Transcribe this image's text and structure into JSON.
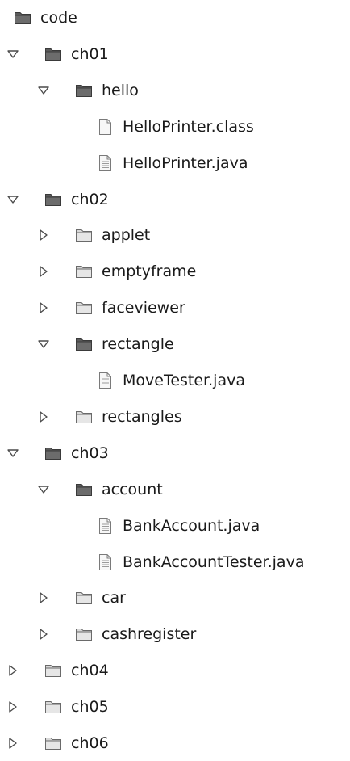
{
  "tree": {
    "nodes": [
      {
        "label": "code",
        "type": "folder",
        "level": 0,
        "toggle": "none",
        "icon": "folder-dark-icon"
      },
      {
        "label": "ch01",
        "type": "folder",
        "level": 0,
        "toggle": "expanded",
        "icon": "folder-dark-icon"
      },
      {
        "label": "hello",
        "type": "folder",
        "level": 1,
        "toggle": "expanded",
        "icon": "folder-dark-icon"
      },
      {
        "label": "HelloPrinter.class",
        "type": "file",
        "level": 2,
        "toggle": "none",
        "icon": "file-icon"
      },
      {
        "label": "HelloPrinter.java",
        "type": "file",
        "level": 2,
        "toggle": "none",
        "icon": "java-file-icon"
      },
      {
        "label": "ch02",
        "type": "folder",
        "level": 0,
        "toggle": "expanded",
        "icon": "folder-dark-icon"
      },
      {
        "label": "applet",
        "type": "folder",
        "level": 1,
        "toggle": "collapsed",
        "icon": "folder-light-icon"
      },
      {
        "label": "emptyframe",
        "type": "folder",
        "level": 1,
        "toggle": "collapsed",
        "icon": "folder-light-icon"
      },
      {
        "label": "faceviewer",
        "type": "folder",
        "level": 1,
        "toggle": "collapsed",
        "icon": "folder-light-icon"
      },
      {
        "label": "rectangle",
        "type": "folder",
        "level": 1,
        "toggle": "expanded",
        "icon": "folder-dark-icon"
      },
      {
        "label": "MoveTester.java",
        "type": "file",
        "level": 2,
        "toggle": "none",
        "icon": "java-file-icon"
      },
      {
        "label": "rectangles",
        "type": "folder",
        "level": 1,
        "toggle": "collapsed",
        "icon": "folder-light-icon"
      },
      {
        "label": "ch03",
        "type": "folder",
        "level": 0,
        "toggle": "expanded",
        "icon": "folder-dark-icon"
      },
      {
        "label": "account",
        "type": "folder",
        "level": 1,
        "toggle": "expanded",
        "icon": "folder-dark-icon"
      },
      {
        "label": "BankAccount.java",
        "type": "file",
        "level": 2,
        "toggle": "none",
        "icon": "java-file-icon"
      },
      {
        "label": "BankAccountTester.java",
        "type": "file",
        "level": 2,
        "toggle": "none",
        "icon": "java-file-icon"
      },
      {
        "label": "car",
        "type": "folder",
        "level": 1,
        "toggle": "collapsed",
        "icon": "folder-light-icon"
      },
      {
        "label": "cashregister",
        "type": "folder",
        "level": 1,
        "toggle": "collapsed",
        "icon": "folder-light-icon"
      },
      {
        "label": "ch04",
        "type": "folder",
        "level": 0,
        "toggle": "collapsed",
        "icon": "folder-light-icon"
      },
      {
        "label": "ch05",
        "type": "folder",
        "level": 0,
        "toggle": "collapsed",
        "icon": "folder-light-icon"
      },
      {
        "label": "ch06",
        "type": "folder",
        "level": 0,
        "toggle": "collapsed",
        "icon": "folder-light-icon"
      }
    ]
  },
  "colors": {
    "text": "#1a1a1a",
    "folder_dark": "#5a5a5a",
    "folder_light": "#d8d8d8",
    "outline": "#4a4a4a",
    "file_fill": "#f7f7f7"
  }
}
